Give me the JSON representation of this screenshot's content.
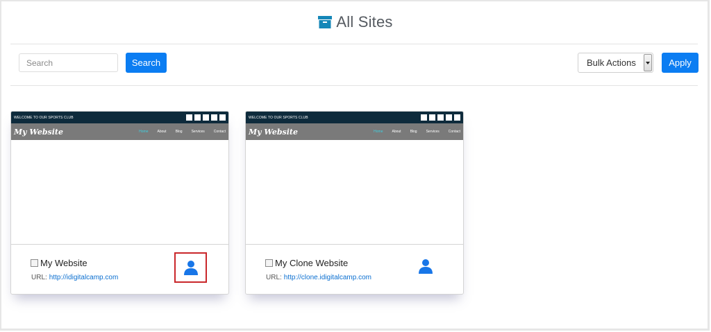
{
  "header": {
    "title": "All Sites",
    "icon": "archive-icon",
    "icon_color": "#1587b8"
  },
  "toolbar": {
    "search_placeholder": "Search",
    "search_label": "Search",
    "bulk_actions": {
      "selected": "Bulk Actions"
    },
    "apply_label": "Apply",
    "accent": "#0b7df2"
  },
  "cards": [
    {
      "preview": {
        "welcome": "WELCOME TO OUR SPORTS CLUB",
        "logo": "My Website",
        "nav": [
          "Home",
          "About",
          "Blog",
          "Services",
          "Contact"
        ]
      },
      "name": "My Website",
      "url_label": "URL:",
      "url": "http://idigitalcamp.com",
      "icon": "user-icon",
      "highlighted": true
    },
    {
      "preview": {
        "welcome": "WELCOME TO OUR SPORTS CLUB",
        "logo": "My Website",
        "nav": [
          "Home",
          "About",
          "Blog",
          "Services",
          "Contact"
        ]
      },
      "name": "My Clone Website",
      "url_label": "URL:",
      "url": "http://clone.idigitalcamp.com",
      "icon": "user-icon",
      "highlighted": false
    }
  ]
}
